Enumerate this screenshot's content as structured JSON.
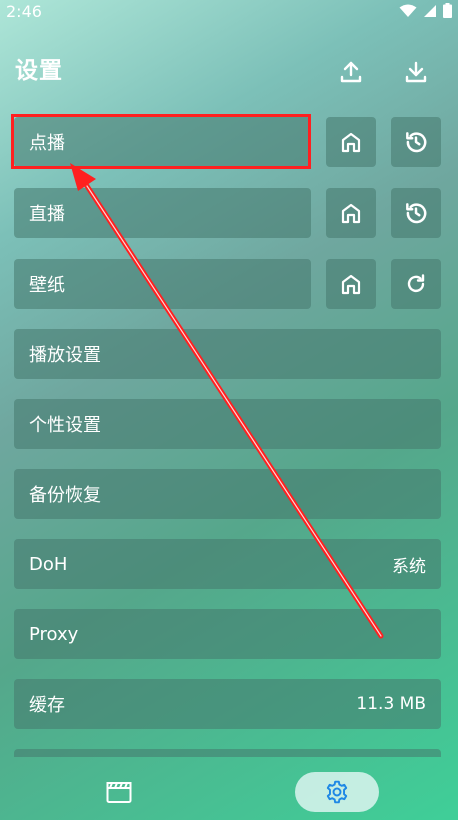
{
  "status": {
    "time": "2:46"
  },
  "header": {
    "title": "设置",
    "upload_icon": "upload-icon",
    "download_icon": "download-icon"
  },
  "rows": [
    {
      "label": "点播",
      "home_icon": "home-icon",
      "action_icon": "history-icon"
    },
    {
      "label": "直播",
      "home_icon": "home-icon",
      "action_icon": "history-icon"
    },
    {
      "label": "壁纸",
      "home_icon": "home-icon",
      "action_icon": "refresh-icon"
    }
  ],
  "settings": [
    {
      "label": "播放设置",
      "value": ""
    },
    {
      "label": "个性设置",
      "value": ""
    },
    {
      "label": "备份恢复",
      "value": ""
    },
    {
      "label": "DoH",
      "value": "系统"
    },
    {
      "label": "Proxy",
      "value": ""
    },
    {
      "label": "缓存",
      "value": "11.3 MB"
    }
  ],
  "nav": [
    {
      "icon": "clapperboard-icon",
      "active": false
    },
    {
      "icon": "gear-icon",
      "active": true
    }
  ],
  "colors": {
    "highlight": "#ff2020",
    "accent": "#1e88e5",
    "annotation_arrow": "#ff2020"
  }
}
